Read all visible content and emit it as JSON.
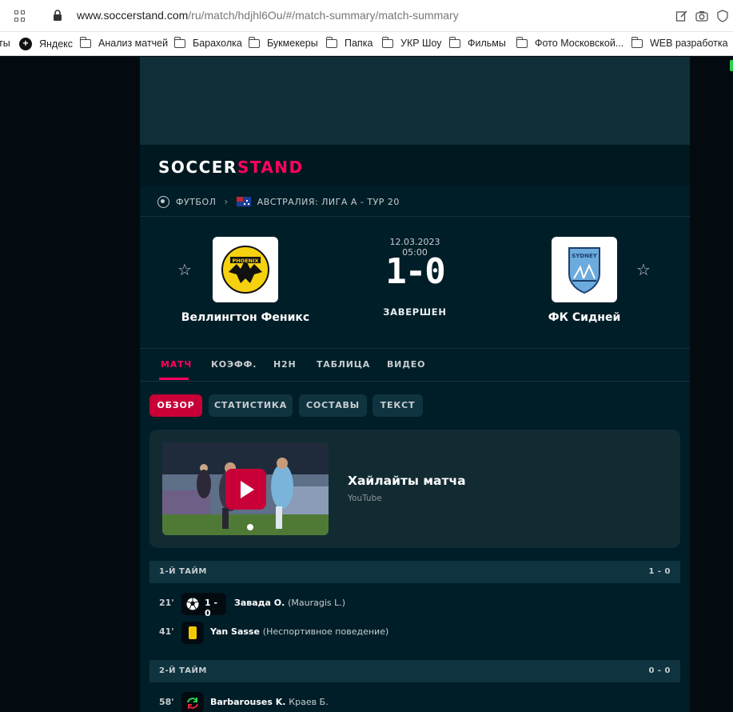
{
  "browser": {
    "url_host": "www.soccerstand.com",
    "url_path": "/ru/match/hdjhl6Ou/#/match-summary/match-summary",
    "bookmarks": [
      {
        "label": "ты",
        "icon": "none"
      },
      {
        "label": "Яндекс",
        "icon": "yandex-icon"
      },
      {
        "label": "Анализ матчей",
        "icon": "folder-icon"
      },
      {
        "label": "Барахолка",
        "icon": "folder-icon"
      },
      {
        "label": "Букмекеры",
        "icon": "folder-icon"
      },
      {
        "label": "Папка",
        "icon": "folder-icon"
      },
      {
        "label": "УКР Шоу",
        "icon": "folder-icon"
      },
      {
        "label": "Фильмы",
        "icon": "folder-icon"
      },
      {
        "label": "Фото Московской...",
        "icon": "folder-icon"
      },
      {
        "label": "WEB разработка",
        "icon": "folder-icon"
      }
    ]
  },
  "site": {
    "logo_part1": "SOCCER",
    "logo_part2": "STAND",
    "brand_color": "#ff025c"
  },
  "breadcrumb": {
    "sport": "ФУТБОЛ",
    "competition": "АВСТРАЛИЯ: ЛИГА А - ТУР 20"
  },
  "match": {
    "datetime": "12.03.2023 05:00",
    "score": "1-0",
    "status": "ЗАВЕРШЕН",
    "home": {
      "name": "Веллингтон Феникс",
      "logo_text": "PHOENIX"
    },
    "away": {
      "name": "ФК Сидней",
      "logo_text": "SYDNEY"
    }
  },
  "tabs": [
    {
      "label": "МАТЧ",
      "active": true
    },
    {
      "label": "КОЭФФ.",
      "active": false
    },
    {
      "label": "H2H",
      "active": false
    },
    {
      "label": "ТАБЛИЦА",
      "active": false
    },
    {
      "label": "ВИДЕО",
      "active": false
    }
  ],
  "subtabs": [
    {
      "label": "ОБЗОР",
      "active": true
    },
    {
      "label": "СТАТИСТИКА",
      "active": false
    },
    {
      "label": "СОСТАВЫ",
      "active": false
    },
    {
      "label": "ТЕКСТ",
      "active": false
    }
  ],
  "highlights": {
    "title": "Хайлайты матча",
    "source": "YouTube"
  },
  "periods": [
    {
      "name": "1-Й ТАЙМ",
      "score": "1 - 0",
      "events": [
        {
          "minute": "21'",
          "type": "goal",
          "icon": "soccer-ball-icon",
          "score": "1 - 0",
          "player": "Завада О.",
          "note": "(Mauragis L.)"
        },
        {
          "minute": "41'",
          "type": "yellow-card",
          "icon": "yellow-card-icon",
          "player": "Yan Sasse",
          "note": "(Неспортивное поведение)"
        }
      ]
    },
    {
      "name": "2-Й ТАЙМ",
      "score": "0 - 0",
      "events": [
        {
          "minute": "58'",
          "type": "substitution",
          "icon": "substitution-icon",
          "player": "Barbarouses K.",
          "note": "Краев Б."
        }
      ]
    }
  ]
}
